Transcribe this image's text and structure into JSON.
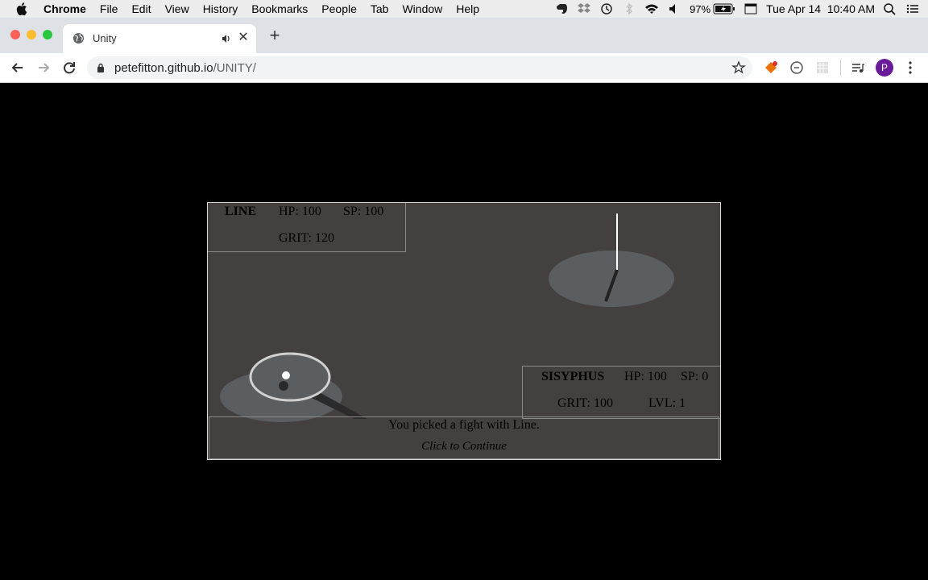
{
  "menubar": {
    "items": [
      "Chrome",
      "File",
      "Edit",
      "View",
      "History",
      "Bookmarks",
      "People",
      "Tab",
      "Window",
      "Help"
    ],
    "battery": "97%",
    "clock": "Tue Apr 14  10:40 AM",
    "icons": [
      "apple-icon",
      "evernote-icon",
      "dropbox-icon",
      "time-machine-icon",
      "bluetooth-icon",
      "wifi-icon",
      "volume-icon",
      "battery-icon",
      "calendar-icon",
      "spotlight-icon",
      "notification-center-icon"
    ]
  },
  "browser": {
    "tab_title": "Unity",
    "url_host": "petefitton.github.io",
    "url_path": "/UNITY/"
  },
  "game": {
    "enemy": {
      "name": "LINE",
      "hp": "HP: 100",
      "sp": "SP: 100",
      "grit": "GRIT: 120"
    },
    "player": {
      "name": "SISYPHUS",
      "hp": "HP: 100",
      "sp": "SP: 0",
      "grit": "GRIT: 100",
      "lvl": "LVL: 1"
    },
    "message": "You picked a fight with Line.",
    "continue_prompt": "Click to Continue"
  },
  "colors": {
    "game_bg": "#454040",
    "platform": "#5a5e60",
    "accent_purple": "#6a1b9a"
  }
}
